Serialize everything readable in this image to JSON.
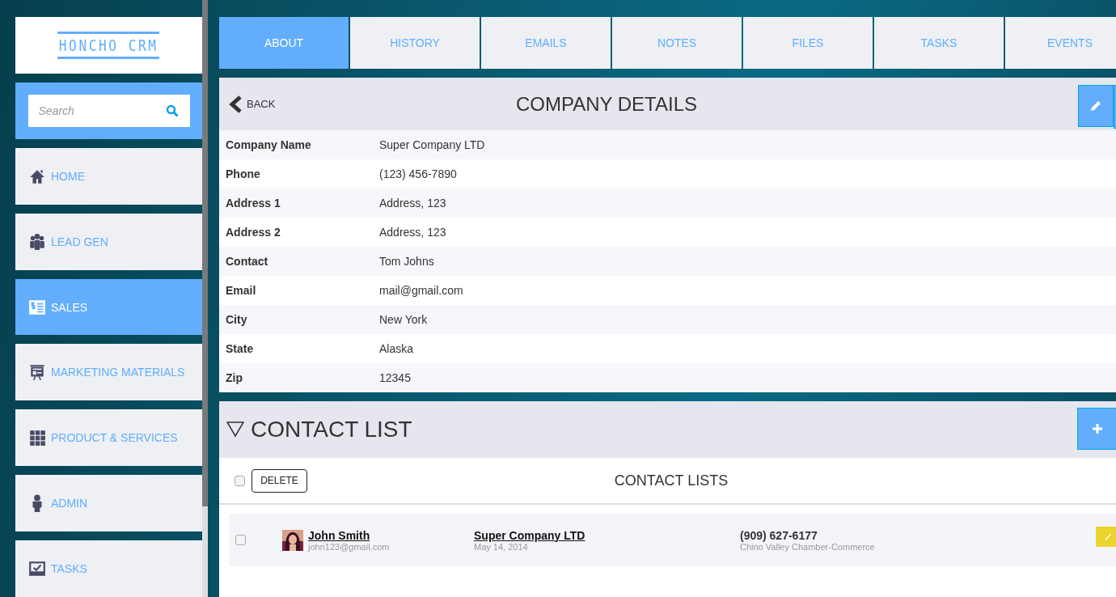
{
  "logo": {
    "text": "HONCHO CRM"
  },
  "search": {
    "placeholder": "Search"
  },
  "sidebar": {
    "items": [
      {
        "label": "HOME",
        "selected": false
      },
      {
        "label": "LEAD GEN",
        "selected": false
      },
      {
        "label": "SALES",
        "selected": true
      },
      {
        "label": "MARKETING MATERIALS",
        "selected": false
      },
      {
        "label": "PRODUCT & SERVICES",
        "selected": false
      },
      {
        "label": "ADMIN",
        "selected": false
      },
      {
        "label": "TASKS",
        "selected": false
      }
    ]
  },
  "tabs": [
    {
      "label": "ABOUT",
      "selected": true
    },
    {
      "label": "HISTORY",
      "selected": false
    },
    {
      "label": "EMAILS",
      "selected": false
    },
    {
      "label": "NOTES",
      "selected": false
    },
    {
      "label": "FILES",
      "selected": false
    },
    {
      "label": "TASKS",
      "selected": false
    },
    {
      "label": "EVENTS",
      "selected": false
    }
  ],
  "company_details": {
    "back": "BACK",
    "title": "COMPANY DETAILS",
    "fields": [
      {
        "label": "Company Name",
        "value": "Super Company LTD"
      },
      {
        "label": "Phone",
        "value": "(123) 456-7890"
      },
      {
        "label": "Address 1",
        "value": "Address, 123"
      },
      {
        "label": "Address 2",
        "value": "Address, 123"
      },
      {
        "label": "Contact",
        "value": "Tom Johns"
      },
      {
        "label": "Email",
        "value": "mail@gmail.com"
      },
      {
        "label": "City",
        "value": "New York"
      },
      {
        "label": "State",
        "value": "Alaska"
      },
      {
        "label": "Zip",
        "value": "12345"
      }
    ]
  },
  "contact_list": {
    "title": "CONTACT LIST",
    "expanded": true,
    "select_all_checked": false,
    "delete": "DELETE",
    "subtitle": "CONTACT LISTS",
    "rows": [
      {
        "checked": false,
        "name": "John Smith",
        "email": "john123@gmail.com",
        "company": "Super Company LTD",
        "date": "May 14, 2014",
        "phone": "(909) 627-6177",
        "organization": "Chino Valley Chamber-Commerce"
      }
    ]
  }
}
